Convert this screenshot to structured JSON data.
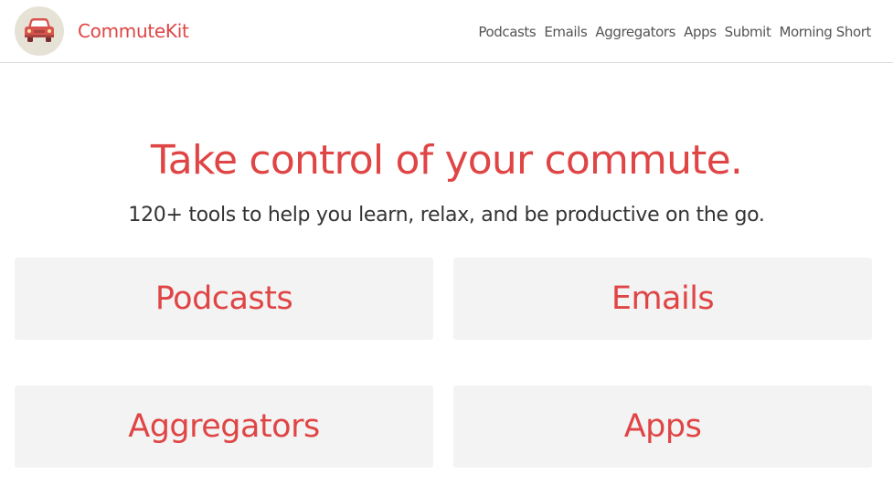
{
  "header": {
    "brand": "CommuteKit",
    "logo_icon": "car-icon",
    "nav": [
      "Podcasts",
      "Emails",
      "Aggregators",
      "Apps",
      "Submit",
      "Morning Short"
    ]
  },
  "hero": {
    "title": "Take control of your commute.",
    "subtitle": "120+ tools to help you learn, relax, and be productive on the go."
  },
  "categories": [
    "Podcasts",
    "Emails",
    "Aggregators",
    "Apps"
  ],
  "colors": {
    "accent": "#e04545",
    "card_bg": "#f3f3f3",
    "logo_bg": "#e6e2d6",
    "nav_text": "#555555"
  }
}
